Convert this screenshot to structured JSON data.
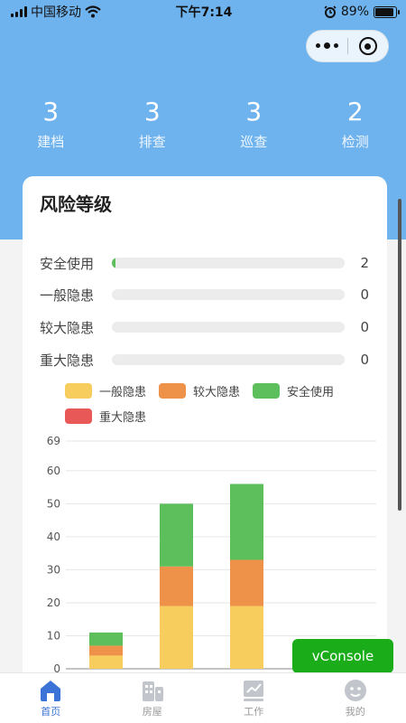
{
  "status_bar": {
    "carrier": "中国移动",
    "time": "下午7:14",
    "battery": "89%",
    "battery_level": 0.89
  },
  "stats": [
    {
      "value": "3",
      "label": "建档"
    },
    {
      "value": "3",
      "label": "排查"
    },
    {
      "value": "3",
      "label": "巡查"
    },
    {
      "value": "2",
      "label": "检测"
    }
  ],
  "card": {
    "title": "风险等级",
    "risk_rows": [
      {
        "label": "安全使用",
        "count": "2",
        "fill": 0.01
      },
      {
        "label": "一般隐患",
        "count": "0",
        "fill": 0
      },
      {
        "label": "较大隐患",
        "count": "0",
        "fill": 0
      },
      {
        "label": "重大隐患",
        "count": "0",
        "fill": 0
      }
    ],
    "legend": [
      {
        "name": "一般隐患",
        "color": "#f7cd5e"
      },
      {
        "name": "较大隐患",
        "color": "#ee9149"
      },
      {
        "name": "安全使用",
        "color": "#5cbf5c"
      },
      {
        "name": "重大隐患",
        "color": "#e85856"
      }
    ]
  },
  "chart_data": {
    "type": "bar",
    "stacked": true,
    "ylim": [
      0,
      69
    ],
    "yticks": [
      0,
      10,
      20,
      30,
      40,
      50,
      60,
      69
    ],
    "categories": [
      "",
      "",
      ""
    ],
    "series": [
      {
        "name": "一般隐患",
        "color": "#f7cd5e",
        "values": [
          4,
          19,
          19
        ]
      },
      {
        "name": "较大隐患",
        "color": "#ee9149",
        "values": [
          3,
          12,
          14
        ]
      },
      {
        "name": "安全使用",
        "color": "#5cbf5c",
        "values": [
          4,
          19,
          23
        ]
      },
      {
        "name": "重大隐患",
        "color": "#e85856",
        "values": [
          0,
          0,
          0
        ]
      }
    ],
    "grid": true
  },
  "vconsole": {
    "label": "vConsole"
  },
  "tabbar": [
    {
      "label": "首页",
      "icon": "home-icon",
      "active": true
    },
    {
      "label": "房屋",
      "icon": "building-icon",
      "active": false
    },
    {
      "label": "工作",
      "icon": "work-chart-icon",
      "active": false
    },
    {
      "label": "我的",
      "icon": "profile-icon",
      "active": false
    }
  ]
}
